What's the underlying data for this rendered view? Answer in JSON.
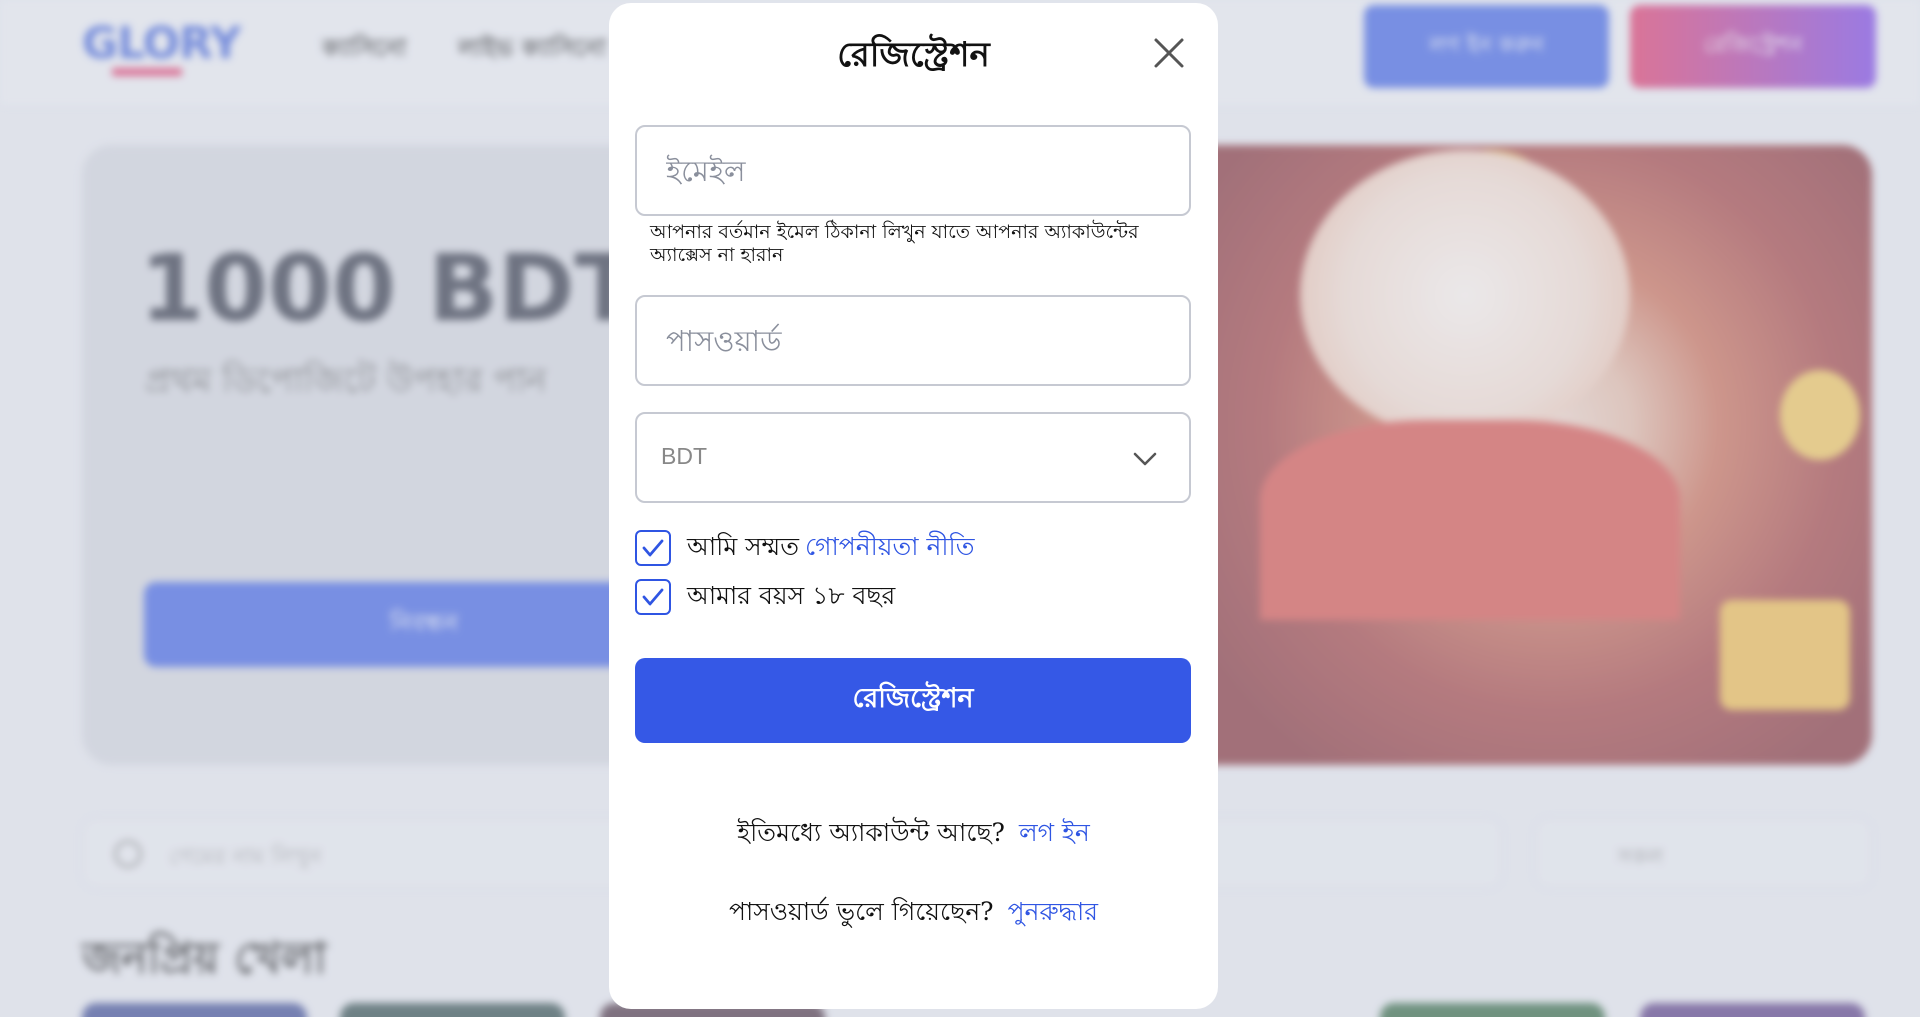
{
  "background": {
    "logo": "GLORY",
    "nav": [
      "ক্যাসিনো",
      "লাইভ ক্যাসিনো"
    ],
    "header_buttons": {
      "login": "লগ ইন করুন",
      "register": "রেজিস্ট্রেশন"
    },
    "banner": {
      "title": "1000 BDT",
      "subtitle": "প্রথম ডিপোজিটে উপহার পান",
      "button": "নিবন্ধন"
    },
    "search_placeholder": "গেমের নাম লিখুন",
    "sort_label": "সকল",
    "section_title": "জনপ্রিয় খেলা",
    "colors": {
      "primary": "#2f55e3",
      "accent": "#e0245a"
    }
  },
  "modal": {
    "title": "রেজিস্ট্রেশন",
    "close_icon": "close-icon",
    "email": {
      "placeholder": "ইমেইল",
      "value": "",
      "hint": "আপনার বর্তমান ইমেল ঠিকানা লিখুন যাতে আপনার অ্যাকাউন্টের অ্যাক্সেস না হারান"
    },
    "password": {
      "placeholder": "পাসওয়ার্ড",
      "value": ""
    },
    "currency": {
      "selected": "BDT",
      "icon": "chevron-down-icon"
    },
    "agree_privacy": {
      "checked": true,
      "label": "আমি সম্মত",
      "link": "গোপনীয়তা নীতি"
    },
    "agree_age": {
      "checked": true,
      "label": "আমার বয়স ১৮ বছর"
    },
    "submit_label": "রেজিস্ট্রেশন",
    "have_account": {
      "text": "ইতিমধ্যে অ্যাকাউন্ট আছে?",
      "link": "লগ ইন"
    },
    "forgot": {
      "text": "পাসওয়ার্ড ভুলে গিয়েছেন?",
      "link": "পুনরুদ্ধার"
    },
    "colors": {
      "primary": "#3558e6",
      "link": "#2f55e3",
      "border": "#c6c9d2"
    }
  }
}
